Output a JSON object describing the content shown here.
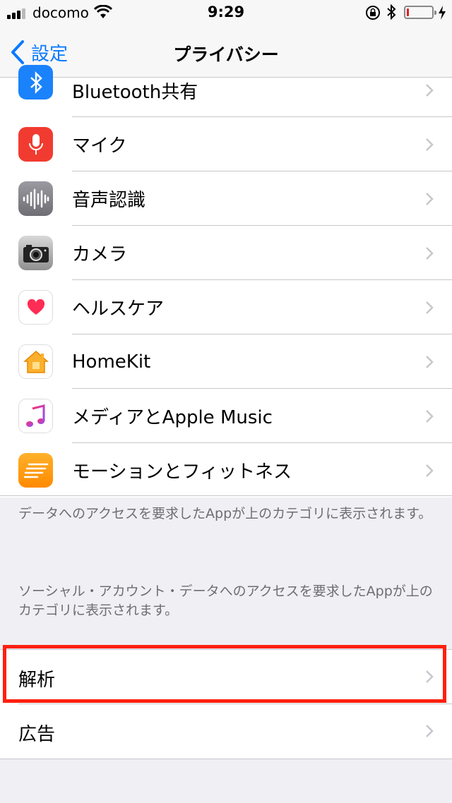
{
  "status_bar": {
    "carrier": "docomo",
    "time": "9:29",
    "battery_level": 0.05,
    "icons": [
      "signal-icon",
      "wifi-icon",
      "rotation-lock-icon",
      "bluetooth-icon",
      "battery-icon",
      "charging-icon"
    ]
  },
  "nav": {
    "back_label": "設定",
    "title": "プライバシー"
  },
  "items": [
    {
      "label": "Bluetooth共有",
      "icon": "bluetooth-icon",
      "color": "#1a82fb"
    },
    {
      "label": "マイク",
      "icon": "microphone-icon",
      "color": "#f23b30"
    },
    {
      "label": "音声認識",
      "icon": "waveform-icon",
      "color": "#8e8e93"
    },
    {
      "label": "カメラ",
      "icon": "camera-icon",
      "color": "#9a9a9a"
    },
    {
      "label": "ヘルスケア",
      "icon": "heart-icon",
      "color": "#ff2d55"
    },
    {
      "label": "HomeKit",
      "icon": "home-icon",
      "color": "#fbb02d"
    },
    {
      "label": "メディアとApple Music",
      "icon": "music-note-icon",
      "color": "#fa2f6c"
    },
    {
      "label": "モーションとフィットネス",
      "icon": "motion-icon",
      "color": "#ff9500"
    }
  ],
  "notes": {
    "apps_note": "データへのアクセスを要求したAppが上のカテゴリに表示されます。",
    "social_note": "ソーシャル・アカウント・データへのアクセスを要求したAppが上のカテゴリに表示されます。"
  },
  "group2": [
    {
      "label": "解析",
      "highlighted": true
    },
    {
      "label": "広告"
    }
  ],
  "colors": {
    "accent": "#0a7aff",
    "highlight": "#ff1f0f"
  }
}
